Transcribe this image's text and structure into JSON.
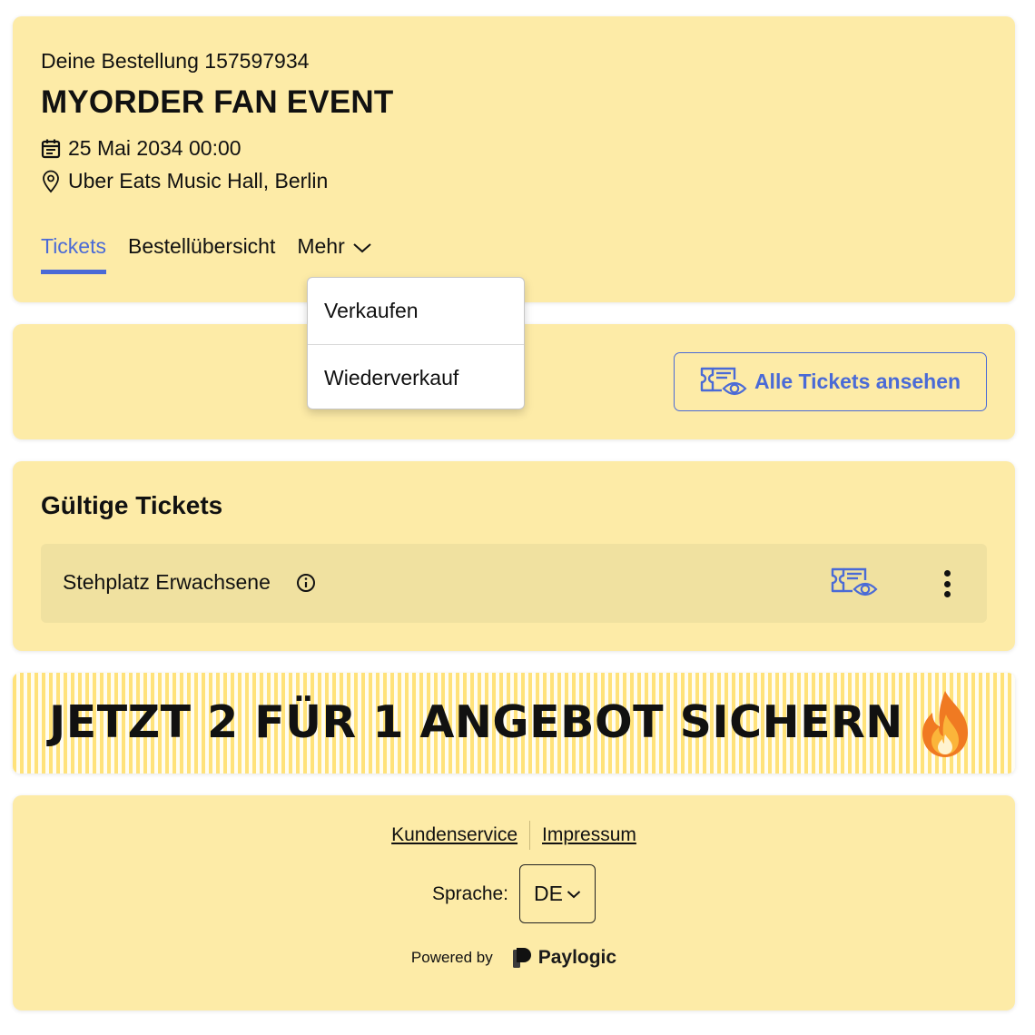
{
  "order": {
    "label": "Deine Bestellung 157597934",
    "event_title": "MYORDER FAN EVENT",
    "date": "25 Mai 2034 00:00",
    "venue": "Uber Eats Music Hall, Berlin"
  },
  "tabs": [
    {
      "label": "Tickets",
      "active": true
    },
    {
      "label": "Bestellübersicht",
      "active": false
    },
    {
      "label": "Mehr",
      "active": false
    }
  ],
  "dropdown": {
    "items": [
      {
        "label": "Verkaufen"
      },
      {
        "label": "Wiederverkauf"
      }
    ]
  },
  "actions": {
    "all_tickets_label": "Alle Tickets ansehen"
  },
  "valid_tickets": {
    "title": "Gültige Tickets",
    "items": [
      {
        "name": "Stehplatz Erwachsene"
      }
    ]
  },
  "banner": {
    "text": "JETZT 2 FÜR 1 ANGEBOT SICHERN"
  },
  "footer": {
    "links": [
      "Kundenservice",
      "Impressum"
    ],
    "language_label": "Sprache:",
    "language_value": "DE",
    "powered_by": "Powered by",
    "brand": "Paylogic"
  },
  "colors": {
    "card_bg": "#fdeba7",
    "accent": "#4a6ad6",
    "ticket_row_bg": "#f0e1a0"
  },
  "icons": [
    "calendar-icon",
    "location-pin-icon",
    "chevron-down-icon",
    "ticket-eye-icon",
    "info-icon",
    "kebab-menu-icon",
    "flame-icon",
    "paylogic-logo-icon"
  ]
}
